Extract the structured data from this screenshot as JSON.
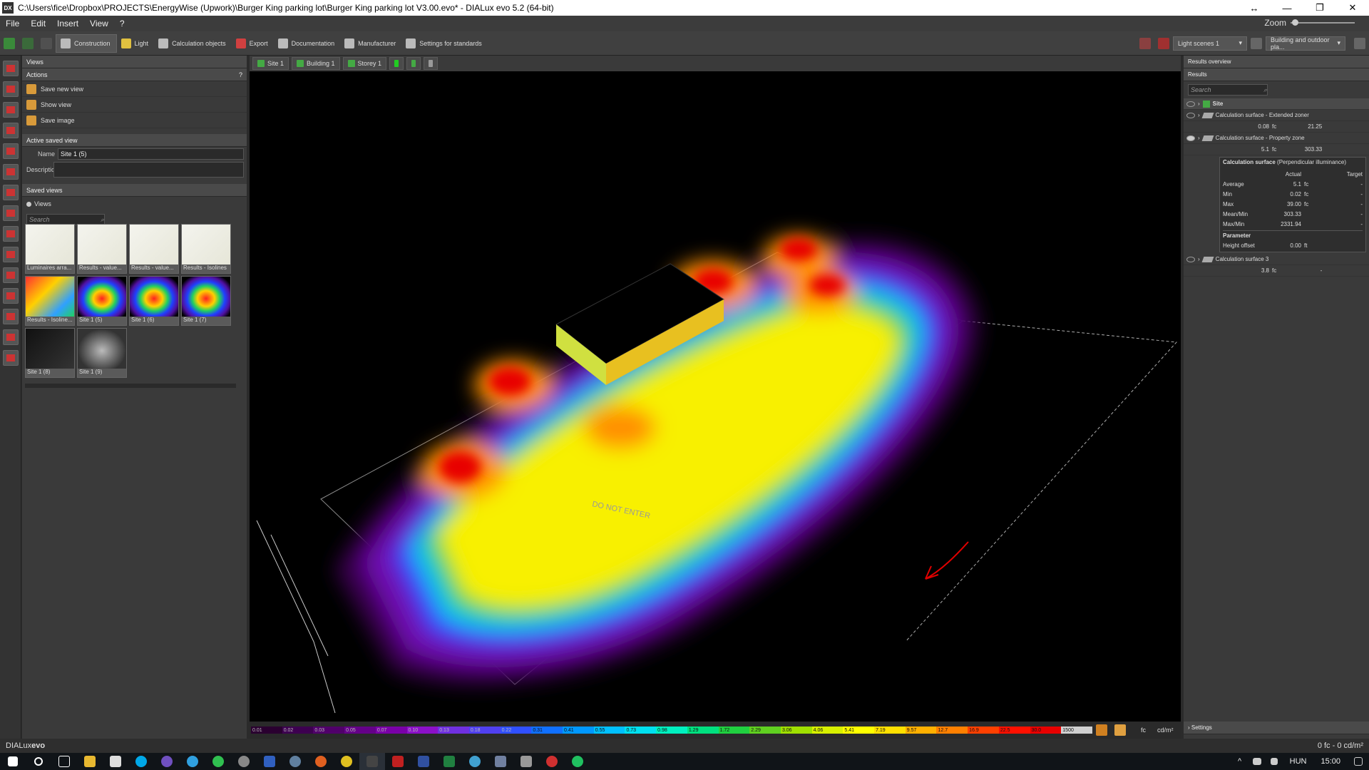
{
  "window": {
    "title": "C:\\Users\\fice\\Dropbox\\PROJECTS\\EnergyWise (Upwork)\\Burger King parking lot\\Burger King parking lot V3.00.evo* - DIALux evo 5.2  (64-bit)",
    "app_icon_text": "DX",
    "controls": [
      "↔",
      "—",
      "❐",
      "✕"
    ]
  },
  "menu": {
    "items": [
      "File",
      "Edit",
      "Insert",
      "View",
      "?"
    ],
    "zoom_label": "Zoom"
  },
  "toolbar": {
    "tabs": [
      "Construction",
      "Light",
      "Calculation objects",
      "Export",
      "Documentation",
      "Manufacturer",
      "Settings for standards"
    ],
    "active_tab": "Construction",
    "light_scene": "Light scenes 1",
    "scene_type": "Building and outdoor pla..."
  },
  "views_panel": {
    "header": "Views",
    "actions_header": "Actions",
    "help": "?",
    "actions": [
      "Save new view",
      "Show view",
      "Save image"
    ],
    "active_header": "Active saved view",
    "name_label": "Name",
    "name_value": "Site 1 (5)",
    "description_label": "Description",
    "description_value": "",
    "saved_header": "Saved views",
    "saved_radio": "Views",
    "search_placeholder": "Search",
    "thumbnails": [
      {
        "caption": "Luminaires arra...",
        "kind": "plan"
      },
      {
        "caption": "Results - value...",
        "kind": "plan"
      },
      {
        "caption": "Results - value...",
        "kind": "plan"
      },
      {
        "caption": "Results - Isolines",
        "kind": "plan"
      },
      {
        "caption": "Results - Isoline...",
        "kind": "heat"
      },
      {
        "caption": "Site 1 (5)",
        "kind": "heatdark"
      },
      {
        "caption": "Site 1 (6)",
        "kind": "heatdark"
      },
      {
        "caption": "Site 1 (7)",
        "kind": "heatdark"
      },
      {
        "caption": "Site 1 (8)",
        "kind": "dark"
      },
      {
        "caption": "Site 1 (9)",
        "kind": "grey"
      }
    ]
  },
  "view_tabs": {
    "items": [
      "Site 1",
      "Building 1",
      "Storey 1"
    ]
  },
  "scene": {
    "labels": [
      "DO NOT ENTER"
    ]
  },
  "legend": {
    "values": [
      "0.01",
      "0.02",
      "0.03",
      "0.05",
      "0.07",
      "0.10",
      "0.13",
      "0.18",
      "0.22",
      "0.31",
      "0.41",
      "0.55",
      "0.73",
      "0.98",
      "1.29",
      "1.72",
      "2.29",
      "3.06",
      "4.06",
      "5.41",
      "7.19",
      "9.57",
      "12.7",
      "16.9",
      "22.5",
      "30.0",
      "1500"
    ],
    "colors": [
      "#2a0030",
      "#3d0050",
      "#50006a",
      "#640088",
      "#7a00a8",
      "#8c10c8",
      "#7030e0",
      "#5040f0",
      "#3050ff",
      "#1070ff",
      "#0098ff",
      "#00c0ff",
      "#00e0f0",
      "#00f0c0",
      "#00e080",
      "#20d040",
      "#60d020",
      "#a0e000",
      "#d8f000",
      "#ffff00",
      "#ffe000",
      "#ffb000",
      "#ff8000",
      "#ff4000",
      "#ff1000",
      "#e80000",
      "#d0d0d0"
    ],
    "unit_fc": "fc",
    "unit_cd": "cd/m²"
  },
  "results": {
    "header": "Results overview",
    "sub_header": "Results",
    "search_placeholder": "Search",
    "site_label": "Site",
    "surfaces": [
      {
        "name": "Calculation surface - Extended zoner",
        "min": "0.08",
        "unit": "fc",
        "max": "21.25"
      },
      {
        "name": "Calculation surface - Property zone",
        "min": "5.1",
        "unit": "fc",
        "max": "303.33"
      },
      {
        "name": "Calculation surface 3",
        "min": "3.8",
        "unit": "fc",
        "max": "-"
      }
    ],
    "detail": {
      "title": "Calculation surface",
      "subtitle": "(Perpendicular illuminance)",
      "col_actual": "Actual",
      "col_target": "Target",
      "rows": [
        {
          "name": "Average",
          "actual": "5.1",
          "unit": "fc",
          "target": "-"
        },
        {
          "name": "Min",
          "actual": "0.02",
          "unit": "fc",
          "target": "-"
        },
        {
          "name": "Max",
          "actual": "39.00",
          "unit": "fc",
          "target": "-"
        },
        {
          "name": "Mean/Min",
          "actual": "303.33",
          "unit": "",
          "target": "-"
        },
        {
          "name": "Max/Min",
          "actual": "2331.94",
          "unit": "",
          "target": "-"
        }
      ],
      "param_header": "Parameter",
      "height_label": "Height offset",
      "height_value": "0.00",
      "height_unit": "ft"
    },
    "settings": "Settings"
  },
  "status": {
    "brand_a": "DIALux",
    "brand_b": "evo",
    "readout": "0 fc - 0 cd/m²"
  },
  "taskbar": {
    "language": "HUN",
    "time": "15:00"
  }
}
